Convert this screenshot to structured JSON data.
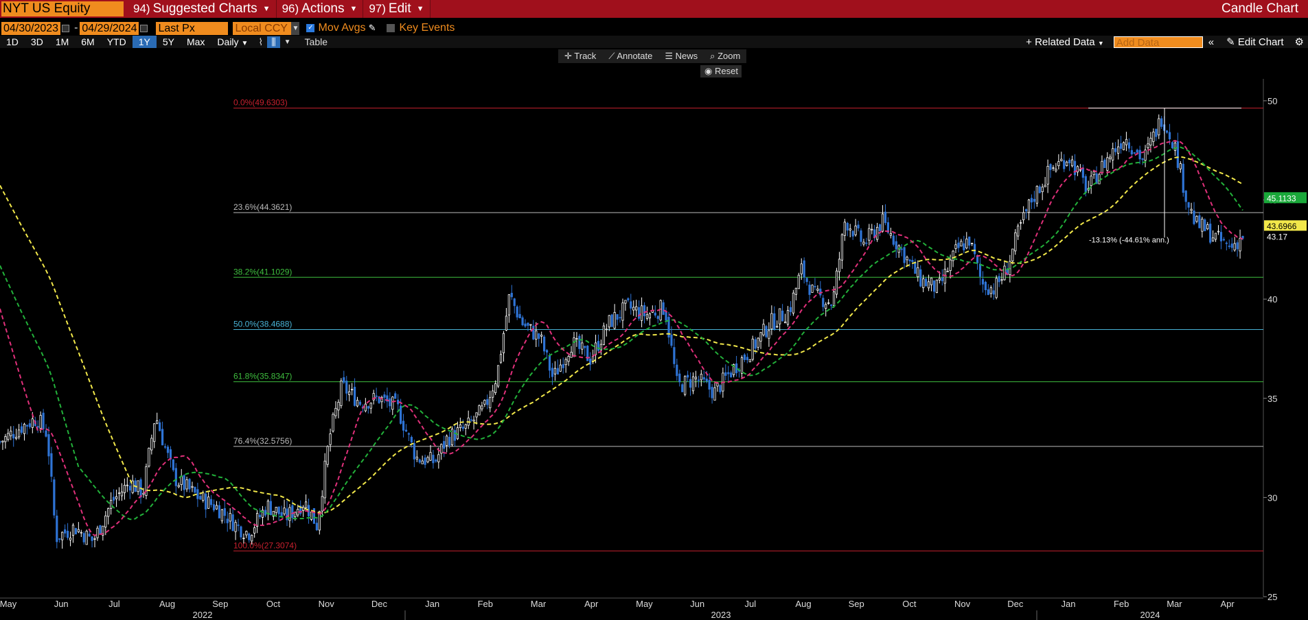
{
  "topbar": {
    "ticker": "NYT US Equity",
    "menus": [
      {
        "num": "94)",
        "label": "Suggested Charts"
      },
      {
        "num": "96)",
        "label": "Actions"
      },
      {
        "num": "97)",
        "label": "Edit"
      }
    ],
    "chart_kind": "Candle Chart"
  },
  "controls": {
    "start_date": "04/30/2023",
    "end_date": "04/29/2024",
    "date_sep": "-",
    "price_field": "Last Px",
    "currency": "Local CCY",
    "mov_avgs": "Mov Avgs",
    "key_events": "Key Events",
    "periods": [
      "1D",
      "3D",
      "1M",
      "6M",
      "YTD",
      "1Y",
      "5Y",
      "Max"
    ],
    "active_period": "1Y",
    "frequency": "Daily",
    "table": "Table",
    "related_data": "Related Data",
    "add_data_placeholder": "Add Data",
    "edit_chart": "Edit Chart"
  },
  "toolbar": {
    "track": "Track",
    "annotate": "Annotate",
    "news": "News",
    "zoom": "Zoom",
    "reset": "Reset"
  },
  "colors": {
    "ma_fast": "#e0307a",
    "ma_mid": "#22b13a",
    "ma_slow": "#f2e84a",
    "candle_up": "#ffffff",
    "candle_down": "#2f74d6"
  },
  "chart_data": {
    "type": "candlestick",
    "ylim": [
      25,
      51
    ],
    "y_ticks": [
      25,
      30,
      35,
      40,
      45,
      50
    ],
    "x_months": [
      "May",
      "Jun",
      "Jul",
      "Aug",
      "Sep",
      "Oct",
      "Nov",
      "Dec",
      "Jan",
      "Feb",
      "Mar",
      "Apr",
      "May",
      "Jun",
      "Jul",
      "Aug",
      "Sep",
      "Oct",
      "Nov",
      "Dec",
      "Jan",
      "Feb",
      "Mar",
      "Apr"
    ],
    "x_years": [
      "2022",
      "2023",
      "2024"
    ],
    "fib_levels": [
      {
        "label": "0.0%(49.6303)",
        "value": 49.6303,
        "color": "#c8202e"
      },
      {
        "label": "23.6%(44.3621)",
        "value": 44.3621,
        "color": "#bbbbbb"
      },
      {
        "label": "38.2%(41.1029)",
        "value": 41.1029,
        "color": "#3fbf3f"
      },
      {
        "label": "50.0%(38.4688)",
        "value": 38.4688,
        "color": "#49b3d6"
      },
      {
        "label": "61.8%(35.8347)",
        "value": 35.8347,
        "color": "#3fbf3f"
      },
      {
        "label": "76.4%(32.5756)",
        "value": 32.5756,
        "color": "#bbbbbb"
      },
      {
        "label": "100.0%(27.3074)",
        "value": 27.3074,
        "color": "#c8202e"
      }
    ],
    "last_value_tags": [
      {
        "label": "45.1133",
        "value": 45.1133,
        "bg": "#1aa83a",
        "fg": "#ffffff"
      },
      {
        "label": "43.6966",
        "value": 43.6966,
        "bg": "#f2e84a",
        "fg": "#000000"
      },
      {
        "label": "43.17",
        "value": 43.17,
        "bg": "#000000",
        "fg": "#ffffff"
      }
    ],
    "annotation": "-13.13% (-44.61% ann.)",
    "close_path": [
      [
        0,
        32.8
      ],
      [
        0.018,
        33.6
      ],
      [
        0.03,
        34.0
      ],
      [
        0.038,
        33.2
      ],
      [
        0.045,
        28.0
      ],
      [
        0.06,
        28.5
      ],
      [
        0.075,
        27.8
      ],
      [
        0.09,
        29.8
      ],
      [
        0.105,
        30.8
      ],
      [
        0.115,
        30.2
      ],
      [
        0.125,
        34.2
      ],
      [
        0.14,
        31.0
      ],
      [
        0.16,
        30.0
      ],
      [
        0.175,
        29.5
      ],
      [
        0.19,
        28.6
      ],
      [
        0.2,
        28.2
      ],
      [
        0.215,
        29.6
      ],
      [
        0.23,
        29.0
      ],
      [
        0.245,
        29.8
      ],
      [
        0.255,
        28.6
      ],
      [
        0.265,
        33.0
      ],
      [
        0.275,
        35.6
      ],
      [
        0.29,
        34.8
      ],
      [
        0.305,
        35.0
      ],
      [
        0.32,
        34.5
      ],
      [
        0.335,
        32.0
      ],
      [
        0.35,
        31.8
      ],
      [
        0.36,
        33.0
      ],
      [
        0.375,
        33.5
      ],
      [
        0.39,
        34.5
      ],
      [
        0.4,
        36.2
      ],
      [
        0.41,
        40.2
      ],
      [
        0.42,
        38.8
      ],
      [
        0.435,
        38.0
      ],
      [
        0.445,
        36.0
      ],
      [
        0.46,
        37.8
      ],
      [
        0.475,
        37.0
      ],
      [
        0.49,
        38.8
      ],
      [
        0.505,
        39.6
      ],
      [
        0.52,
        39.2
      ],
      [
        0.535,
        39.6
      ],
      [
        0.545,
        35.6
      ],
      [
        0.56,
        36.0
      ],
      [
        0.575,
        35.3
      ],
      [
        0.59,
        36.5
      ],
      [
        0.605,
        37.5
      ],
      [
        0.62,
        38.8
      ],
      [
        0.635,
        39.4
      ],
      [
        0.645,
        41.5
      ],
      [
        0.655,
        40.2
      ],
      [
        0.67,
        39.8
      ],
      [
        0.68,
        44.0
      ],
      [
        0.695,
        42.8
      ],
      [
        0.71,
        43.9
      ],
      [
        0.725,
        42.5
      ],
      [
        0.74,
        41.0
      ],
      [
        0.755,
        40.5
      ],
      [
        0.77,
        42.5
      ],
      [
        0.78,
        43.0
      ],
      [
        0.79,
        40.8
      ],
      [
        0.8,
        40.5
      ],
      [
        0.81,
        41.5
      ],
      [
        0.82,
        43.5
      ],
      [
        0.83,
        45.0
      ],
      [
        0.845,
        46.5
      ],
      [
        0.86,
        47.2
      ],
      [
        0.875,
        45.5
      ],
      [
        0.89,
        47.0
      ],
      [
        0.905,
        48.2
      ],
      [
        0.92,
        47.0
      ],
      [
        0.935,
        49.2
      ],
      [
        0.945,
        47.8
      ],
      [
        0.955,
        45.0
      ],
      [
        0.962,
        43.8
      ],
      [
        0.97,
        43.5
      ],
      [
        0.98,
        43.0
      ],
      [
        0.99,
        42.6
      ],
      [
        1.0,
        43.17
      ]
    ]
  }
}
